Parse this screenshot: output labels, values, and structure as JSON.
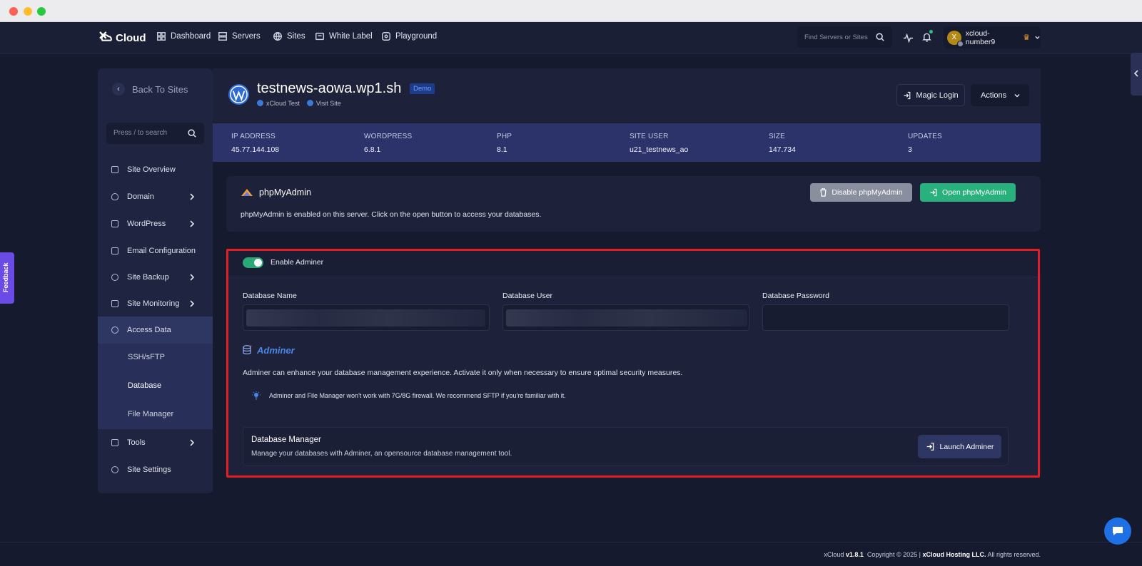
{
  "nav": {
    "logo": "Cloud",
    "items": [
      {
        "label": "Dashboard",
        "icon": "grid-icon"
      },
      {
        "label": "Servers",
        "icon": "server-icon"
      },
      {
        "label": "Sites",
        "icon": "globe-icon"
      },
      {
        "label": "White Label",
        "icon": "tag-icon"
      },
      {
        "label": "Playground",
        "icon": "playground-icon"
      }
    ],
    "search_placeholder": "Find Servers or Sites",
    "user_name": "xcloud-number9",
    "avatar_letter": "X"
  },
  "feedback_label": "Feedback",
  "sidebar": {
    "back_label": "Back To Sites",
    "search_placeholder": "Press / to search",
    "items": [
      {
        "label": "Site Overview"
      },
      {
        "label": "Domain"
      },
      {
        "label": "WordPress"
      },
      {
        "label": "Email Configuration"
      },
      {
        "label": "Site Backup"
      },
      {
        "label": "Site Monitoring"
      },
      {
        "label": "Access Data"
      },
      {
        "label": "Tools"
      },
      {
        "label": "Site Settings"
      }
    ],
    "sub_items": [
      {
        "label": "SSH/sFTP"
      },
      {
        "label": "Database"
      },
      {
        "label": "File Manager"
      }
    ]
  },
  "site": {
    "title": "testnews-aowa.wp1.sh",
    "badge": "Demo",
    "server_link": "xCloud Test",
    "visit_link": "Visit Site",
    "magic_login": "Magic Login",
    "actions": "Actions"
  },
  "stats": [
    {
      "label": "IP ADDRESS",
      "value": "45.77.144.108"
    },
    {
      "label": "WORDPRESS",
      "value": "6.8.1"
    },
    {
      "label": "PHP",
      "value": "8.1"
    },
    {
      "label": "SITE USER",
      "value": "u21_testnews_ao"
    },
    {
      "label": "SIZE",
      "value": "147.734"
    },
    {
      "label": "UPDATES",
      "value": "3"
    }
  ],
  "phpmyadmin": {
    "title": "phpMyAdmin",
    "description": "phpMyAdmin is enabled on this server. Click on the open button to access your databases.",
    "disable_label": "Disable phpMyAdmin",
    "open_label": "Open phpMyAdmin"
  },
  "adminer": {
    "toggle_label": "Enable Adminer",
    "toggle_on": true,
    "fields": [
      {
        "label": "Database Name"
      },
      {
        "label": "Database User"
      },
      {
        "label": "Database Password"
      }
    ],
    "logo_text": "Adminer",
    "description": "Adminer can enhance your database management experience. Activate it only when necessary to ensure optimal security measures.",
    "warning": "Adminer and File Manager won't work with 7G/8G firewall. We recommend SFTP if you're familiar with it.",
    "manager_title": "Database Manager",
    "manager_desc": "Manage your databases with Adminer, an opensource database management tool.",
    "launch_label": "Launch Adminer"
  },
  "footer": {
    "brand": "xCloud",
    "version": "v1.8.1",
    "copyright": "Copyright © 2025 |",
    "company": "xCloud Hosting LLC.",
    "rights": "All rights reserved."
  },
  "colors": {
    "accent_green": "#28b07d",
    "highlight_red": "#e51d25",
    "background": "#161a2e"
  }
}
